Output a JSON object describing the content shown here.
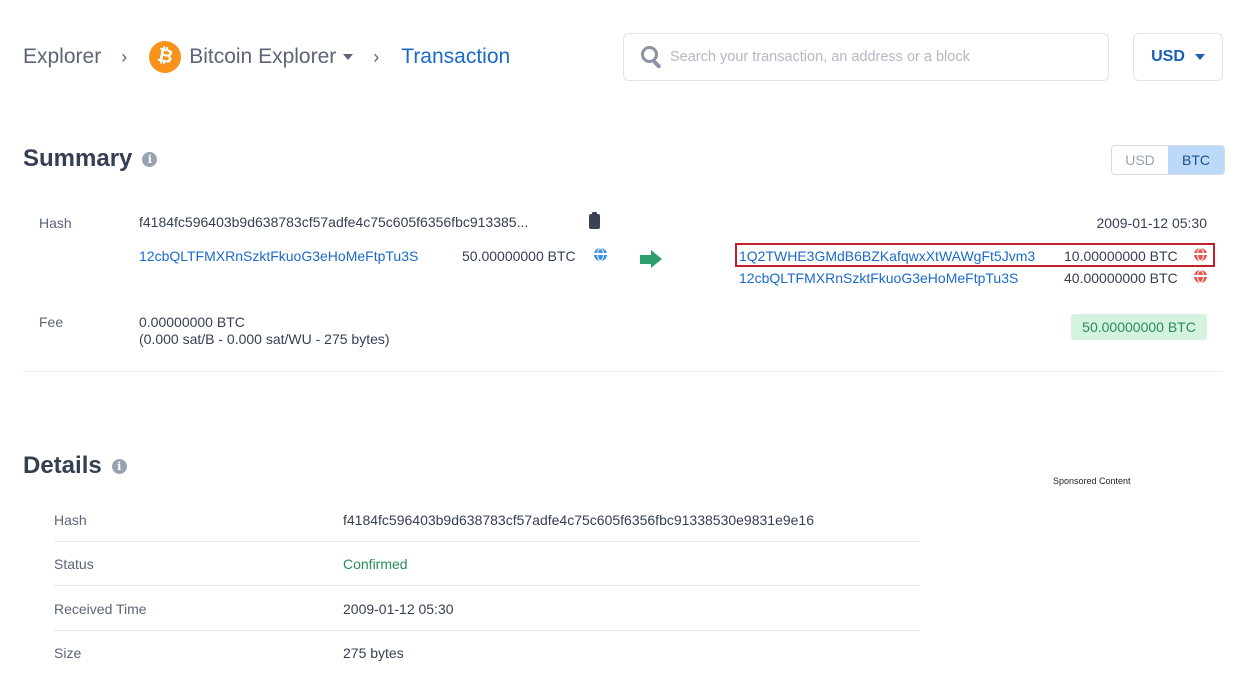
{
  "breadcrumb": {
    "root": "Explorer",
    "separator": "›",
    "coin": "Bitcoin Explorer",
    "coin_icon": "bitcoin-logo",
    "coin_symbol": "₿",
    "current": "Transaction"
  },
  "search": {
    "placeholder": "Search your transaction, an address or a block",
    "value": ""
  },
  "currency_selector": {
    "selected": "USD"
  },
  "summary": {
    "title": "Summary",
    "info_icon": "i",
    "unit_toggle": {
      "options": [
        "USD",
        "BTC"
      ],
      "selected": "BTC"
    },
    "hash_label": "Hash",
    "hash_truncated": "f4184fc596403b9d638783cf57adfe4c75c605f6356fbc913385...",
    "timestamp": "2009-01-12 05:30",
    "inputs": [
      {
        "address": "12cbQLTFMXRnSzktFkuoG3eHoMeFtpTu3S",
        "amount": "50.00000000 BTC"
      }
    ],
    "outputs": [
      {
        "address": "1Q2TWHE3GMdB6BZKafqwxXtWAWgFt5Jvm3",
        "amount": "10.00000000 BTC",
        "highlighted": true
      },
      {
        "address": "12cbQLTFMXRnSzktFkuoG3eHoMeFtpTu3S",
        "amount": "40.00000000 BTC",
        "highlighted": false
      }
    ],
    "fee_label": "Fee",
    "fee_value": "0.00000000 BTC",
    "fee_detail": "(0.000 sat/B - 0.000 sat/WU - 275 bytes)",
    "total": "50.00000000 BTC"
  },
  "details": {
    "title": "Details",
    "info_icon": "i",
    "sponsored_label": "Sponsored Content",
    "rows": [
      {
        "key": "Hash",
        "value": "f4184fc596403b9d638783cf57adfe4c75c605f6356fbc91338530e9831e9e16"
      },
      {
        "key": "Status",
        "value": "Confirmed"
      },
      {
        "key": "Received Time",
        "value": "2009-01-12 05:30"
      },
      {
        "key": "Size",
        "value": "275 bytes"
      }
    ]
  },
  "colors": {
    "link": "#1b6ac9",
    "bitcoin_orange": "#f7931a",
    "confirmed_green": "#2a8a5a",
    "highlight_red": "#c0202a"
  }
}
